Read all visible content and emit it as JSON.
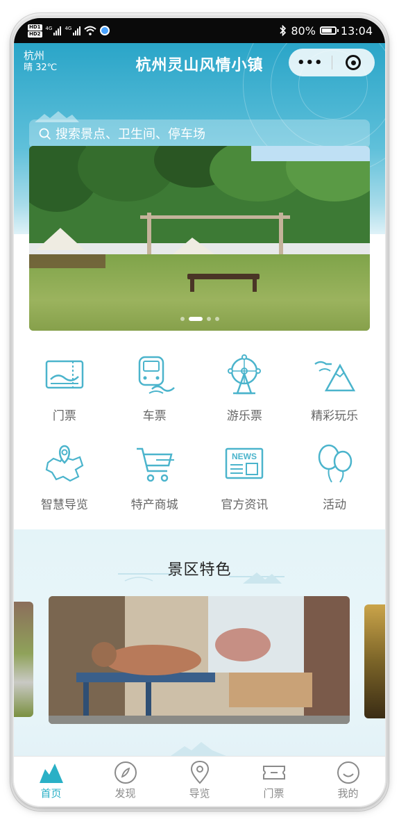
{
  "status_bar": {
    "hd1": "HD1",
    "hd2": "HD2",
    "net1": "4G",
    "net2": "4G",
    "battery_percent": "80%",
    "time": "13:04",
    "battery_level": 0.8
  },
  "header": {
    "city": "杭州",
    "weather": "晴 32℃",
    "title": "杭州灵山风情小镇"
  },
  "search": {
    "placeholder": "搜索景点、卫生间、停车场"
  },
  "banner": {
    "slides": 4,
    "active_slide": 1
  },
  "grid": {
    "row1": [
      {
        "label": "门票",
        "icon": "ticket-landscape-icon"
      },
      {
        "label": "车票",
        "icon": "train-icon"
      },
      {
        "label": "游乐票",
        "icon": "ferris-wheel-icon"
      },
      {
        "label": "精彩玩乐",
        "icon": "mountain-wave-icon"
      }
    ],
    "row2": [
      {
        "label": "智慧导览",
        "icon": "map-pin-icon"
      },
      {
        "label": "特产商城",
        "icon": "cart-icon"
      },
      {
        "label": "官方资讯",
        "icon": "news-icon"
      },
      {
        "label": "活动",
        "icon": "balloons-icon"
      }
    ],
    "news_text": "NEWS"
  },
  "features": {
    "title": "景区特色"
  },
  "tabbar": {
    "items": [
      {
        "label": "首页",
        "icon": "mountain-home-icon",
        "active": true
      },
      {
        "label": "发现",
        "icon": "compass-icon",
        "active": false
      },
      {
        "label": "导览",
        "icon": "location-pin-icon",
        "active": false
      },
      {
        "label": "门票",
        "icon": "ticket-icon",
        "active": false
      },
      {
        "label": "我的",
        "icon": "smile-face-icon",
        "active": false
      }
    ]
  },
  "colors": {
    "accent": "#2ab0c6",
    "header_top": "#2aa5c8",
    "icon_stroke": "#4bb4cc"
  }
}
